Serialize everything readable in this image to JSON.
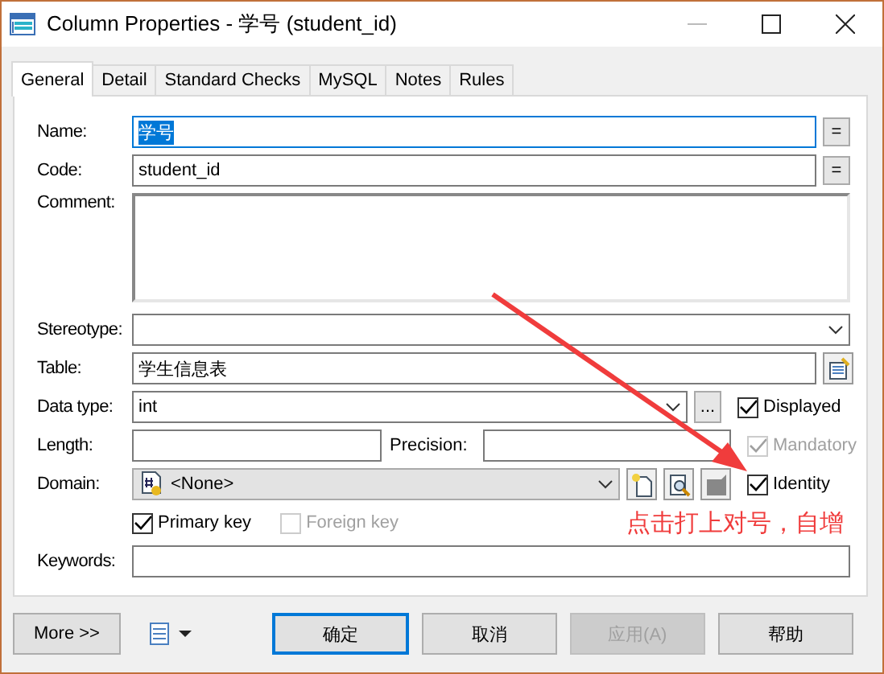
{
  "window": {
    "title": "Column Properties - 学号 (student_id)"
  },
  "tabs": [
    {
      "label": "General",
      "selected": true
    },
    {
      "label": "Detail",
      "selected": false
    },
    {
      "label": "Standard Checks",
      "selected": false
    },
    {
      "label": "MySQL",
      "selected": false
    },
    {
      "label": "Notes",
      "selected": false
    },
    {
      "label": "Rules",
      "selected": false
    }
  ],
  "form": {
    "name": {
      "label": "Name:",
      "value": "学号",
      "text_selected": true,
      "button": "="
    },
    "code": {
      "label": "Code:",
      "value": "student_id",
      "text_selected": false,
      "button": "="
    },
    "comment": {
      "label": "Comment:"
    },
    "stereotype": {
      "label": "Stereotype:"
    },
    "table": {
      "label": "Table:",
      "value": "学生信息表"
    },
    "data_type": {
      "label": "Data type:",
      "value": "int",
      "button": "..."
    },
    "length": {
      "label": "Length:"
    },
    "precision": {
      "label": "Precision:"
    },
    "domain": {
      "label": "Domain:",
      "value": "<None>"
    },
    "keywords": {
      "label": "Keywords:"
    },
    "checkboxes": [
      {
        "kind": "displayed",
        "label": "Displayed",
        "checked": true,
        "disabled": false
      },
      {
        "kind": "mandatory",
        "label": "Mandatory",
        "checked": true,
        "disabled": true
      },
      {
        "kind": "identity",
        "label": "Identity",
        "checked": true,
        "disabled": false
      },
      {
        "kind": "primary",
        "label": "Primary key",
        "checked": true,
        "disabled": false
      },
      {
        "kind": "foreign",
        "label": "Foreign key",
        "checked": false,
        "disabled": true
      }
    ]
  },
  "annotation": {
    "text": "点击打上对号，自增"
  },
  "buttons": [
    {
      "label": "More >>",
      "kind": "more",
      "disabled": false
    },
    {
      "label": "确定",
      "kind": "default",
      "disabled": false
    },
    {
      "label": "取消",
      "kind": "normal",
      "disabled": false
    },
    {
      "label": "应用(A)",
      "kind": "normal",
      "disabled": true
    },
    {
      "label": "帮助",
      "kind": "normal",
      "disabled": false
    }
  ]
}
